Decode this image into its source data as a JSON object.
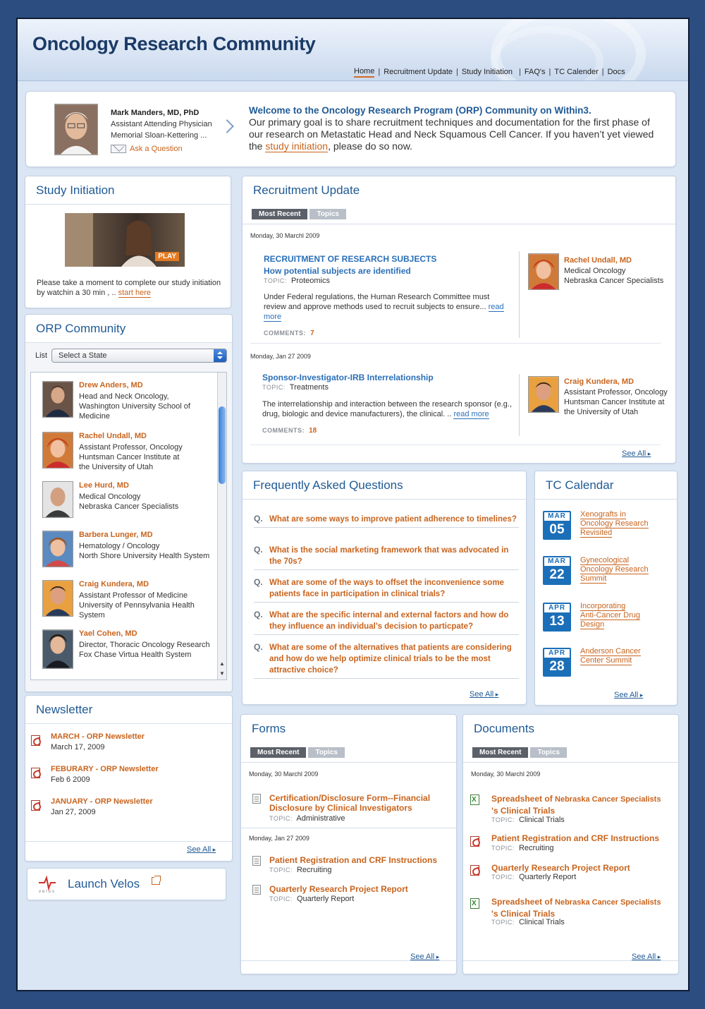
{
  "header": {
    "title": "Oncology Research Community"
  },
  "nav": {
    "items": [
      {
        "label": "Home"
      },
      {
        "label": "Recruitment Update"
      },
      {
        "label": "Study Initiation"
      },
      {
        "label": "FAQ's"
      },
      {
        "label": "TC Calender"
      },
      {
        "label": "Docs"
      }
    ]
  },
  "welcome": {
    "person_name": "Mark Manders, MD, PhD",
    "person_title": "Assistant Attending Physician",
    "person_org": "Memorial Sloan-Kettering ...",
    "ask": "Ask a Question",
    "heading": "Welcome to the Oncology Research Program (ORP) Community on Within3.",
    "text_before": "Our primary goal is to share recruitment techniques and documentation for the first phase of our research on Metastatic Head and Neck Squamous Cell Cancer. If you haven’t yet viewed the ",
    "link": "study initiation",
    "text_after": ", please do so now."
  },
  "study": {
    "title": "Study Initiation",
    "play": "PLAY",
    "text": "Please take a moment to complete our study initiation by watchin a 30 min , .. ",
    "link": "start here"
  },
  "community": {
    "title": "ORP Community",
    "list_label": "List",
    "select": "Select a State",
    "members": [
      {
        "name": "Drew Anders, MD",
        "l1": "Head and Neck Oncology,",
        "l2": "Washington University School of",
        "l3": "Medicine"
      },
      {
        "name": "Rachel Undall, MD",
        "l1": "Assistant Professor, Oncology",
        "l2": "Huntsman Cancer Institute at",
        "l3": "the University of Utah"
      },
      {
        "name": "Lee Hurd, MD",
        "l1": "Medical Oncology",
        "l2": "Nebraska Cancer Specialists",
        "l3": ""
      },
      {
        "name": "Barbera Lunger, MD",
        "l1": "Hematology / Oncology",
        "l2": "North Shore University Health System",
        "l3": ""
      },
      {
        "name": "Craig Kundera, MD",
        "l1": "Assistant Professor of Medicine",
        "l2": "University of Pennsylvania Health",
        "l3": "System"
      },
      {
        "name": "Yael Cohen, MD",
        "l1": "Director, Thoracic Oncology Research",
        "l2": "Fox Chase Virtua Health System",
        "l3": ""
      }
    ]
  },
  "newsletter": {
    "title": "Newsletter",
    "items": [
      {
        "label": "MARCH - ORP Newsletter",
        "date": "March 17, 2009"
      },
      {
        "label": "FEBURARY - ORP Newsletter",
        "date": "Feb 6 2009"
      },
      {
        "label": "JANUARY - ORP Newsletter",
        "date": "Jan 27, 2009"
      }
    ],
    "see_all": "See All"
  },
  "velos": {
    "label": "Launch Velos",
    "logo_text": "velos"
  },
  "recruitment": {
    "title": "Recruitment Update",
    "tab1": "Most Recent",
    "tab2": "Topics",
    "posts": [
      {
        "date": "Monday, 30 Marchl 2009",
        "title": "RECRUITMENT OF RESEARCH SUBJECTS",
        "subtitle": "How potential subjects are identified",
        "topic_label": "TOPIC:",
        "topic": "Proteomics",
        "text": "Under Federal regulations, the Human Research Committee must review and approve methods used to recruit subjects to ensure... ",
        "more": "read more",
        "comments_label": "COMMENTS:",
        "comments": "7",
        "author": "Rachel Undall, MD",
        "a1": "Medical Oncology",
        "a2": "Nebraska Cancer Specialists",
        "a3": ""
      },
      {
        "date": "Monday, Jan 27 2009",
        "title": "Sponsor-Investigator-IRB Interrelationship",
        "subtitle": "",
        "topic_label": "TOPIC:",
        "topic": "Treatments",
        "text": "The interrelationship and interaction between the research sponsor (e.g., drug, biologic and device manufacturers), the clinical. .. ",
        "more": "read more",
        "comments_label": "COMMENTS:",
        "comments": "18",
        "author": "Craig Kundera, MD",
        "a1": "Assistant Professor, Oncology",
        "a2": "Huntsman Cancer Institute at",
        "a3": "the University of Utah"
      }
    ],
    "see_all": "See All"
  },
  "faq": {
    "title": "Frequently Asked Questions",
    "q": "Q.",
    "items": [
      "What are some ways to improve patient adherence to timelines?",
      "What is the social marketing framework that was advocated in the 70s?",
      "What are some of the ways to offset the inconvenience some patients face in participation in clinical trials?",
      "What are the specific internal and external factors and how do they influence an individual’s decision to particpate?",
      "What are some of the alternatives that patients are considering and how do we help optimize clinical trials to be the most attractive choice?"
    ],
    "see_all": "See All"
  },
  "calendar": {
    "title": "TC Calendar",
    "events": [
      {
        "month": "MAR",
        "day": "05",
        "l1": "Xenografts in",
        "l2": "Oncology Research",
        "l3": "Revisited"
      },
      {
        "month": "MAR",
        "day": "22",
        "l1": "Gynecological",
        "l2": "Oncology Research",
        "l3": "Summit"
      },
      {
        "month": "APR",
        "day": "13",
        "l1": "Incorporating",
        "l2": "Anti-Cancer Drug",
        "l3": "Design"
      },
      {
        "month": "APR",
        "day": "28",
        "l1": "Anderson Cancer",
        "l2": "Center Summit",
        "l3": ""
      }
    ],
    "see_all": "See All"
  },
  "forms": {
    "title": "Forms",
    "tab1": "Most Recent",
    "tab2": "Topics",
    "date1": "Monday, 30 Marchl 2009",
    "date2": "Monday, Jan 27 2009",
    "items": [
      {
        "l1": "Certification/Disclosure Form--Financial",
        "l2": "Disclosure by Clinical Investigators",
        "topic_label": "TOPIC:",
        "topic": "Administrative"
      },
      {
        "l1": "Patient Registration and CRF Instructions",
        "l2": "",
        "topic_label": "TOPIC:",
        "topic": "Recruiting"
      },
      {
        "l1": "Quarterly Research Project Report",
        "l2": "",
        "topic_label": "TOPIC:",
        "topic": "Quarterly Report"
      }
    ],
    "see_all": "See All"
  },
  "documents": {
    "title": "Documents",
    "tab1": "Most Recent",
    "tab2": "Topics",
    "date1": "Monday, 30 Marchl 2009",
    "items": [
      {
        "type": "xls",
        "l1a": "Spreadsheet of ",
        "l1b": "Nebraska Cancer Specialists",
        "l2": "'s Clinical Trials",
        "topic_label": "TOPIC:",
        "topic": "Clinical Trials"
      },
      {
        "type": "pdf",
        "l1a": "Patient Registration and CRF Instructions",
        "l1b": "",
        "l2": "",
        "topic_label": "TOPIC:",
        "topic": "Recruiting"
      },
      {
        "type": "pdf",
        "l1a": "Quarterly Research Project Report",
        "l1b": "",
        "l2": "",
        "topic_label": "TOPIC:",
        "topic": "Quarterly Report"
      },
      {
        "type": "xls",
        "l1a": "Spreadsheet of ",
        "l1b": "Nebraska Cancer Specialists",
        "l2": "'s Clinical Trials",
        "topic_label": "TOPIC:",
        "topic": "Clinical Trials"
      }
    ],
    "see_all": "See All"
  }
}
